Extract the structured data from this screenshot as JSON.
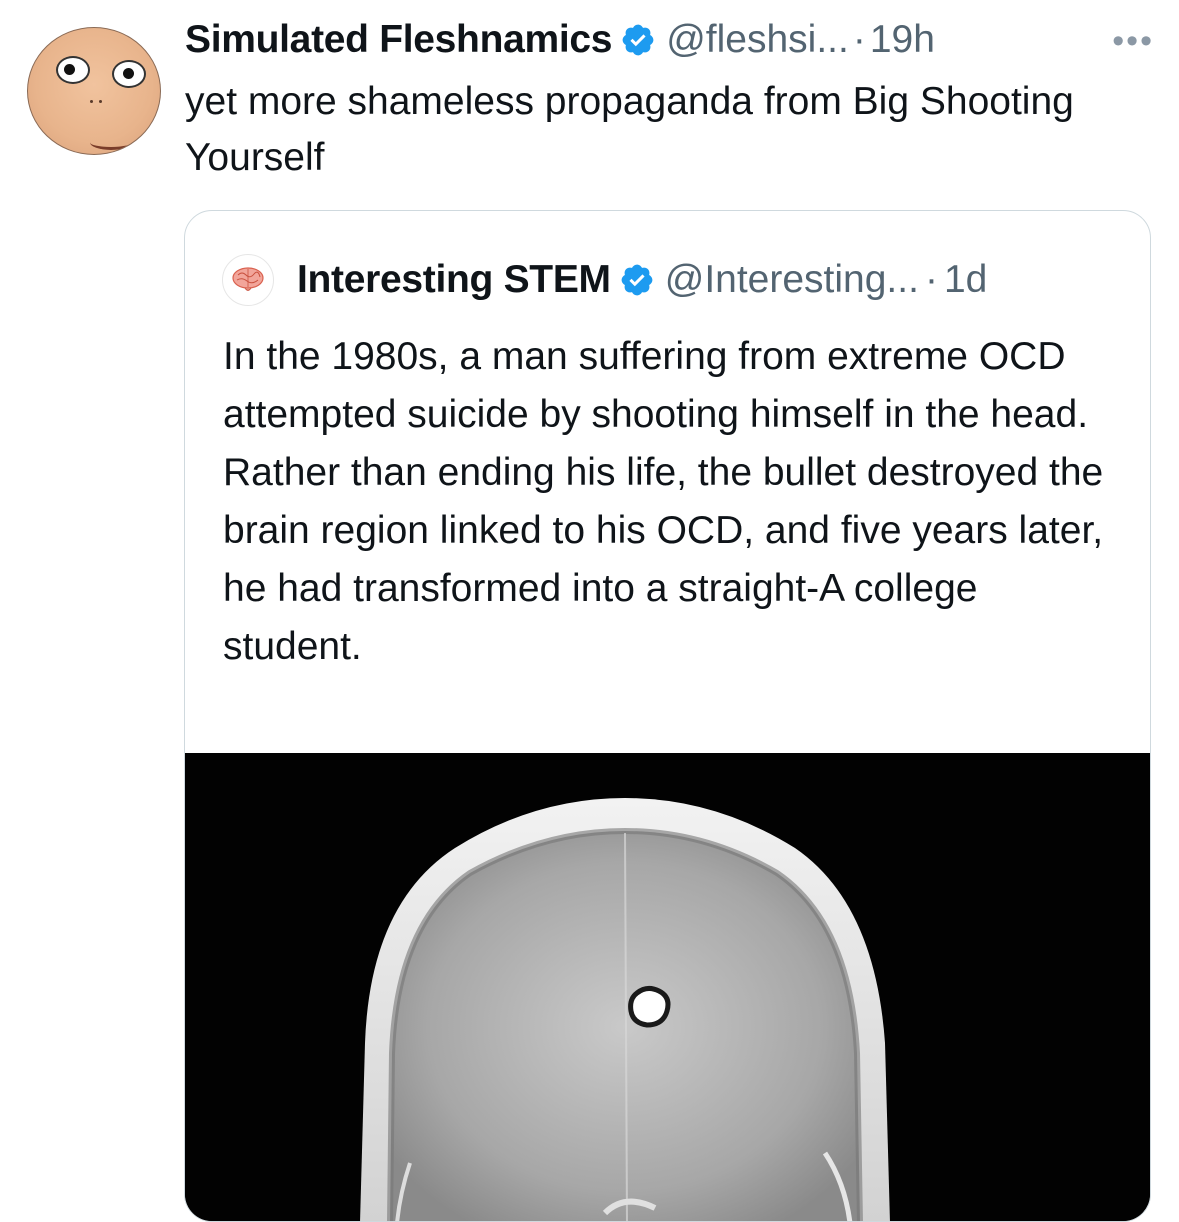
{
  "tweet": {
    "author_name": "Simulated Fleshnamics",
    "author_handle": "@fleshsi...",
    "dot": "·",
    "time": "19h",
    "more_label": "•••",
    "text": "yet more shameless propaganda from Big Shooting Yourself",
    "avatar_icon": "cartoon-face-avatar"
  },
  "quoted": {
    "author_name": "Interesting STEM",
    "author_handle": "@Interesting...",
    "dot": "·",
    "time": "1d",
    "text": "In the 1980s, a man suffering from extreme OCD attempted suicide by shooting himself in the head. Rather than ending his life, the bullet destroyed the brain region linked to his OCD, and five years later, he had transformed into a straight-A college student.",
    "avatar_icon": "brain-icon",
    "media": "skull-xray-scan"
  },
  "colors": {
    "verified_blue": "#1d9bf0",
    "text_primary": "#0f1419",
    "text_secondary": "#536471",
    "border": "#cfd9de"
  }
}
